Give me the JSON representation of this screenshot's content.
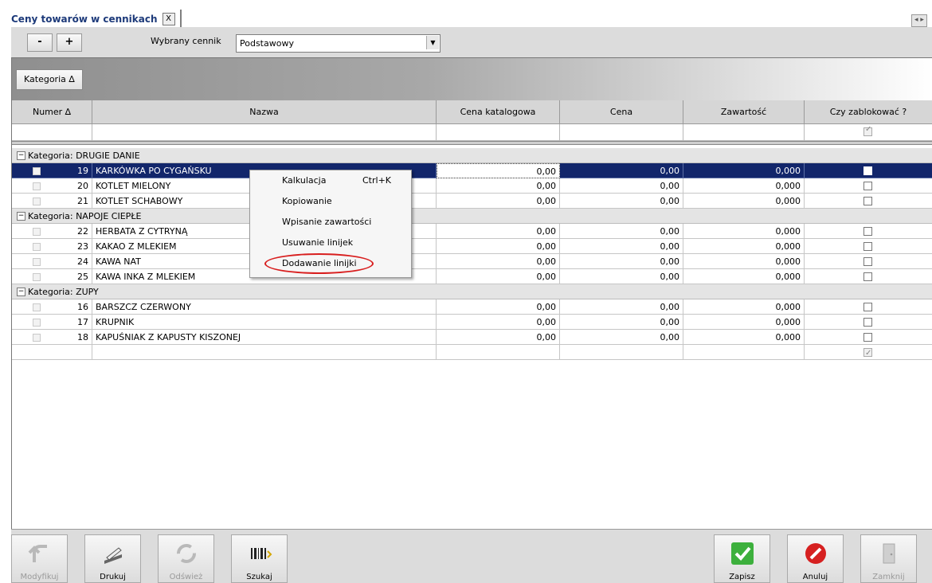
{
  "tab": {
    "title": "Ceny towarów w cennikach",
    "close": "X",
    "nav": "◂ ▸"
  },
  "toolbar": {
    "minus": "-",
    "plus": "+",
    "cennik_label": "Wybrany cennik",
    "cennik_value": "Podstawowy"
  },
  "group_panel": {
    "chip": "Kategoria ∆"
  },
  "columns": {
    "numer": "Numer ∆",
    "nazwa": "Nazwa",
    "cena_katalogowa": "Cena katalogowa",
    "cena": "Cena",
    "zawartosc": "Zawartość",
    "zablokowac": "Czy zablokować ?"
  },
  "groups": [
    {
      "label": "Kategoria: DRUGIE DANIE",
      "rows": [
        {
          "numer": "19",
          "nazwa": "KARKÓWKA PO CYGAŃSKU",
          "cena_kat": "0,00",
          "cena": "0,00",
          "zaw": "0,000",
          "selected": true
        },
        {
          "numer": "20",
          "nazwa": "KOTLET MIELONY",
          "cena_kat": "0,00",
          "cena": "0,00",
          "zaw": "0,000"
        },
        {
          "numer": "21",
          "nazwa": "KOTLET SCHABOWY",
          "cena_kat": "0,00",
          "cena": "0,00",
          "zaw": "0,000"
        }
      ]
    },
    {
      "label": "Kategoria: NAPOJE CIEPŁE",
      "rows": [
        {
          "numer": "22",
          "nazwa": "HERBATA Z CYTRYNĄ",
          "cena_kat": "0,00",
          "cena": "0,00",
          "zaw": "0,000"
        },
        {
          "numer": "23",
          "nazwa": "KAKAO Z  MLEKIEM",
          "cena_kat": "0,00",
          "cena": "0,00",
          "zaw": "0,000"
        },
        {
          "numer": "24",
          "nazwa": "KAWA NAT",
          "cena_kat": "0,00",
          "cena": "0,00",
          "zaw": "0,000"
        },
        {
          "numer": "25",
          "nazwa": "KAWA INKA Z MLEKIEM",
          "cena_kat": "0,00",
          "cena": "0,00",
          "zaw": "0,000"
        }
      ]
    },
    {
      "label": "Kategoria: ZUPY",
      "rows": [
        {
          "numer": "16",
          "nazwa": "BARSZCZ CZERWONY",
          "cena_kat": "0,00",
          "cena": "0,00",
          "zaw": "0,000"
        },
        {
          "numer": "17",
          "nazwa": "KRUPNIK",
          "cena_kat": "0,00",
          "cena": "0,00",
          "zaw": "0,000"
        },
        {
          "numer": "18",
          "nazwa": "KAPUŚNIAK Z KAPUSTY KISZONEJ",
          "cena_kat": "0,00",
          "cena": "0,00",
          "zaw": "0,000"
        }
      ]
    }
  ],
  "context_menu": {
    "items": [
      {
        "label": "Kalkulacja",
        "shortcut": "Ctrl+K"
      },
      {
        "label": "Kopiowanie"
      },
      {
        "label": "Wpisanie zawartości"
      },
      {
        "label": "Usuwanie linijek"
      },
      {
        "label": "Dodawanie linijki",
        "highlighted": true
      }
    ]
  },
  "bottom_buttons": {
    "modyfikuj": "Modyfikuj",
    "drukuj": "Drukuj",
    "odswiez": "Odśwież",
    "szukaj": "Szukaj",
    "zapisz": "Zapisz",
    "anuluj": "Anuluj",
    "zamknij": "Zamknij"
  },
  "colors": {
    "selection": "#12266b",
    "highlight_oval": "#d81e1e",
    "tab_title": "#1d3a7a"
  }
}
